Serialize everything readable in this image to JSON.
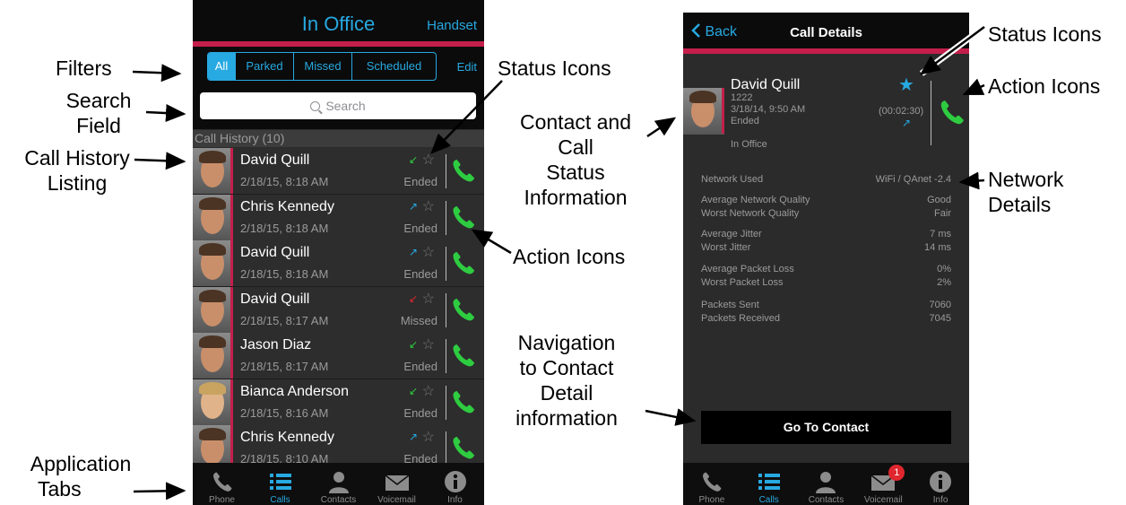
{
  "annotations": {
    "filters": "Filters",
    "search_field": [
      "Search",
      "Field"
    ],
    "call_history": [
      "Call History",
      "Listing"
    ],
    "application_tabs": [
      "Application",
      "Tabs"
    ],
    "status_icons_left": "Status Icons",
    "action_icons_left": "Action Icons",
    "contact_status": [
      "Contact and",
      "Call",
      "Status",
      "Information"
    ],
    "navigation": [
      "Navigation",
      "to Contact",
      "Detail",
      "information"
    ],
    "status_icons_right": "Status Icons",
    "action_icons_right": "Action Icons",
    "network_details": [
      "Network",
      "Details"
    ]
  },
  "left_phone": {
    "title": "In Office",
    "handset": "Handset",
    "filters": [
      "All",
      "Parked",
      "Missed",
      "Scheduled"
    ],
    "active_filter": "All",
    "edit": "Edit",
    "search_placeholder": "Search",
    "history_header": "Call History (10)",
    "calls": [
      {
        "name": "David Quill",
        "date": "2/18/15, 8:18 AM",
        "status": "Ended",
        "direction": "incoming",
        "color": "#2ecc40"
      },
      {
        "name": "Chris Kennedy",
        "date": "2/18/15, 8:18 AM",
        "status": "Ended",
        "direction": "outgoing",
        "color": "#27a9e1"
      },
      {
        "name": "David Quill",
        "date": "2/18/15, 8:18 AM",
        "status": "Ended",
        "direction": "outgoing",
        "color": "#27a9e1"
      },
      {
        "name": "David Quill",
        "date": "2/18/15, 8:17 AM",
        "status": "Missed",
        "direction": "missed",
        "color": "#e0262e"
      },
      {
        "name": "Jason Diaz",
        "date": "2/18/15, 8:17 AM",
        "status": "Ended",
        "direction": "incoming",
        "color": "#2ecc40"
      },
      {
        "name": "Bianca Anderson",
        "date": "2/18/15, 8:16 AM",
        "status": "Ended",
        "direction": "incoming",
        "color": "#2ecc40"
      },
      {
        "name": "Chris Kennedy",
        "date": "2/18/15, 8:10 AM",
        "status": "Ended",
        "direction": "outgoing",
        "color": "#27a9e1"
      }
    ],
    "tabs": [
      "Phone",
      "Calls",
      "Contacts",
      "Voicemail",
      "Info"
    ],
    "active_tab": "Calls"
  },
  "right_phone": {
    "back": "Back",
    "title": "Call Details",
    "contact_name": "David Quill",
    "extension": "1222",
    "datetime": "3/18/14, 9:50 AM",
    "status": "Ended",
    "duration": "(00:02:30)",
    "location": "In Office",
    "network": [
      {
        "label": "Network Used",
        "value": "WiFi / QAnet -2.4"
      },
      {
        "label": "Average Network Quality",
        "value": "Good"
      },
      {
        "label": "Worst Network Quality",
        "value": "Fair"
      },
      {
        "label": "Average Jitter",
        "value": "7 ms"
      },
      {
        "label": "Worst Jitter",
        "value": "14 ms"
      },
      {
        "label": "Average Packet Loss",
        "value": "0%"
      },
      {
        "label": "Worst Packet Loss",
        "value": "2%"
      },
      {
        "label": "Packets Sent",
        "value": "7060"
      },
      {
        "label": "Packets Received",
        "value": "7045"
      }
    ],
    "go_to_contact": "Go To Contact",
    "tabs": [
      "Phone",
      "Calls",
      "Contacts",
      "Voicemail",
      "Info"
    ],
    "active_tab": "Calls",
    "voicemail_badge": "1"
  },
  "colors": {
    "accent": "#27a9e1",
    "brand_red": "#c41f4c",
    "call_green": "#2ecc40"
  }
}
